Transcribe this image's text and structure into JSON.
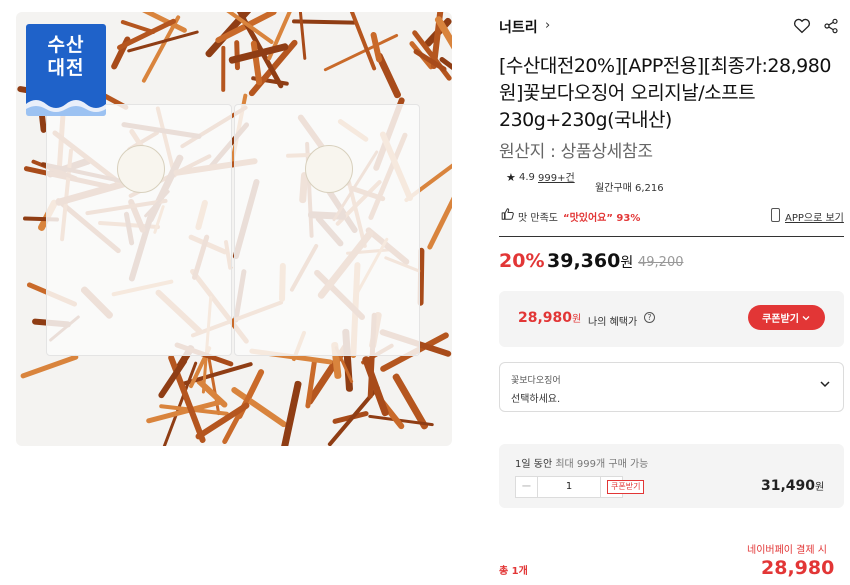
{
  "product_image": {
    "badge_line1": "수산",
    "badge_line2": "대전",
    "badge_color": "#1f62c9"
  },
  "store": {
    "name": "너트리",
    "chevron": "›",
    "heart_icon": "heart-icon",
    "share_icon": "share-icon"
  },
  "product": {
    "title": "[수산대전20%][APP전용][최종가:28,980원]꽃보다오징어 오리지날/소프트 230g+230g(국내산)",
    "origin": "원산지 : 상품상세참조"
  },
  "rating": {
    "star": "★",
    "score": "4.9",
    "reviews": "999+건",
    "monthly_purchases": "월간구매 6,216"
  },
  "satisfaction": {
    "label": "맛 만족도",
    "quote": "“맛있어요” 93%",
    "app_link": "APP으로 보기"
  },
  "price": {
    "discount_rate": "20%",
    "sale_price": "39,360",
    "currency": "원",
    "original_price": "49,200"
  },
  "benefit": {
    "price": "28,980",
    "currency": "원",
    "label": "나의 혜택가",
    "info": "?",
    "coupon_button": "쿠폰받기"
  },
  "option": {
    "name": "꽃보다오징어",
    "placeholder": "선택하세요."
  },
  "quantity": {
    "limit_prefix": "1일 동안",
    "limit_mid": "최대 999개",
    "limit_suffix": "구매 가능",
    "minus": "−",
    "value": "1",
    "plus": "+",
    "coupon_tag": "쿠폰받기",
    "item_price": "31,490",
    "currency": "원"
  },
  "total": {
    "naverpay_label": "네이버페이 결제 시",
    "count": "총 1개",
    "price": "28,980",
    "currency": "원"
  },
  "colors": {
    "accent_red": "#e23636",
    "text": "#222222",
    "muted": "#999999"
  }
}
